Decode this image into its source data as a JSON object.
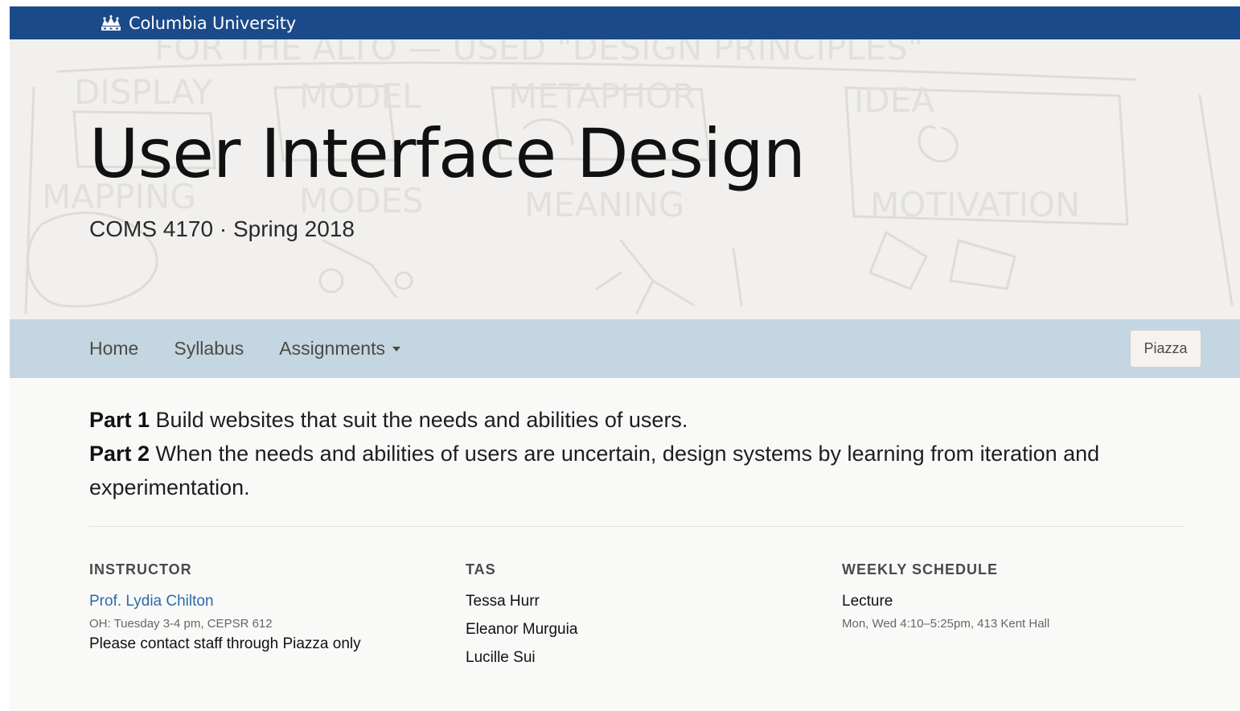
{
  "header": {
    "brand_name": "Columbia University",
    "brand_icon": "crown-icon",
    "brand_color": "#1b4a8a"
  },
  "hero": {
    "title": "User Interface Design",
    "subtitle": "COMS 4170 · Spring 2018"
  },
  "nav": {
    "items": [
      {
        "label": "Home"
      },
      {
        "label": "Syllabus"
      },
      {
        "label": "Assignments"
      }
    ],
    "piazza_label": "Piazza",
    "background_color": "#c3d6e1"
  },
  "intro": {
    "part1_label": "Part 1",
    "part1_text": " Build websites that suit the needs and abilities of users.",
    "part2_label": "Part 2",
    "part2_text": " When the needs and abilities of users are uncertain, design systems by learning from iteration and experimentation."
  },
  "instructor": {
    "heading": "INSTRUCTOR",
    "name": "Prof. Lydia Chilton",
    "office_hours": "OH: Tuesday 3-4 pm, CEPSR 612",
    "contact": "Please contact staff through Piazza only",
    "link_color": "#2d6aa8"
  },
  "tas": {
    "heading": "TAS",
    "names": [
      "Tessa Hurr",
      "Eleanor Murguia",
      "Lucille Sui"
    ]
  },
  "schedule": {
    "heading": "WEEKLY SCHEDULE",
    "item": "Lecture",
    "details": "Mon, Wed 4:10–5:25pm, 413 Kent Hall"
  }
}
